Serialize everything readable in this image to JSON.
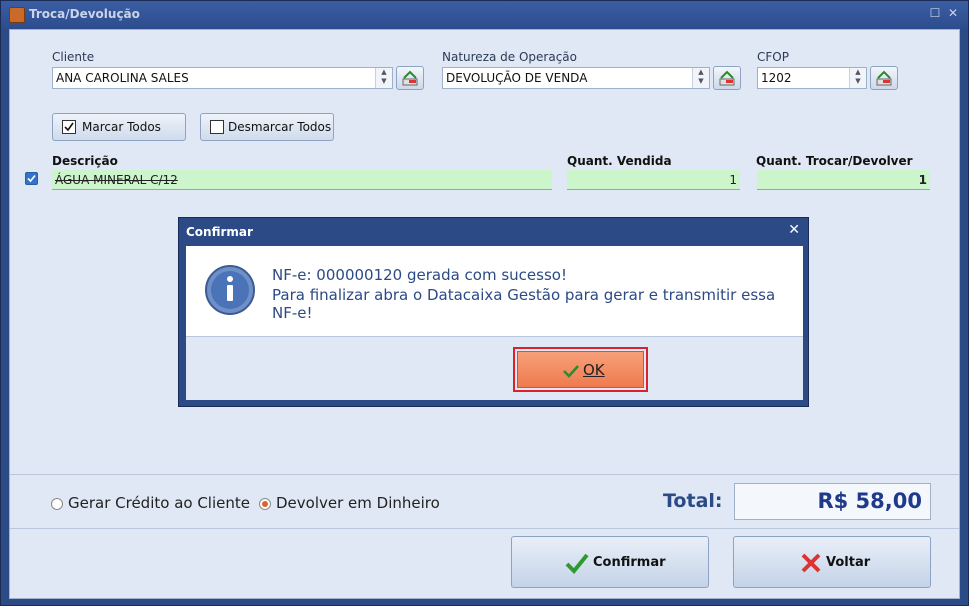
{
  "window": {
    "title": "Troca/Devolução"
  },
  "fields": {
    "cliente_label": "Cliente",
    "cliente_value": "ANA CAROLINA SALES",
    "natureza_label": "Natureza de Operação",
    "natureza_value": "DEVOLUÇÃO DE VENDA",
    "cfop_label": "CFOP",
    "cfop_value": "1202"
  },
  "buttons": {
    "marcar_todos": "Marcar Todos",
    "desmarcar_todos": "Desmarcar Todos",
    "confirmar": "Confirmar",
    "voltar": "Voltar"
  },
  "table": {
    "columns": [
      "Descrição",
      "Quant. Vendida",
      "Quant. Trocar/Devolver"
    ],
    "rows": [
      {
        "checked": true,
        "descricao": "ÁGUA MINERAL C/12",
        "quant_vendida": "1",
        "quant_trocar": "1"
      }
    ]
  },
  "options": {
    "gerar_credito": "Gerar Crédito ao Cliente",
    "devolver_dinheiro": "Devolver em Dinheiro",
    "selected": "devolver_dinheiro"
  },
  "total": {
    "label": "Total:",
    "value": "R$ 58,00"
  },
  "dialog": {
    "title": "Confirmar",
    "line1": "NF-e: 000000120 gerada com sucesso!",
    "line2": "Para finalizar abra o Datacaixa Gestão para gerar e transmitir essa NF-e!",
    "ok_label": "OK"
  },
  "icons": {
    "title": "app-icon",
    "info": "info-icon",
    "confirm": "check-icon",
    "back": "cross-icon"
  },
  "colors": {
    "accent": "#2b4a86",
    "ok_button": "#ef7a4f",
    "highlight_border": "#d9222a",
    "grid_row": "#ccf5cc"
  }
}
